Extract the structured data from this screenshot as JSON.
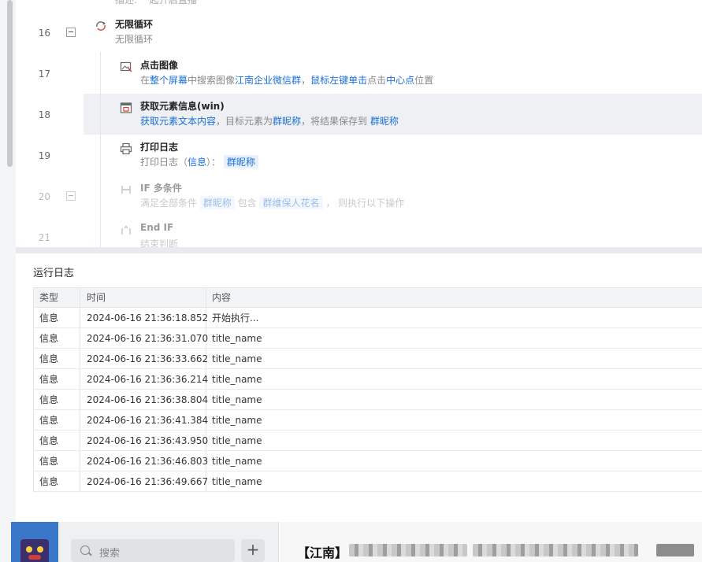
{
  "flow": {
    "top_partial_text": "描述: 一起开启直播",
    "rows": [
      {
        "line": "16",
        "title": "无限循环",
        "desc": "无限循环"
      },
      {
        "line": "17",
        "title": "点击图像",
        "desc_parts": [
          "在",
          "整个屏幕",
          "中搜索图像",
          "江南企业微信群",
          "，",
          "鼠标左键单击",
          "点击",
          "中心点",
          "位置"
        ]
      },
      {
        "line": "18",
        "title": "获取元素信息(win)",
        "desc_parts": [
          "获取元素文本内容",
          "，目标元素为",
          "群昵称",
          "，将结果保存到 ",
          "群昵称"
        ]
      },
      {
        "line": "19",
        "title": "打印日志",
        "desc_parts": [
          "打印日志（",
          "信息",
          "）： ",
          "群昵称"
        ]
      },
      {
        "line": "20",
        "title": "IF 多条件",
        "desc_parts": [
          "满足全部条件 ",
          "群昵称",
          " 包含 ",
          "群维保人花名",
          " ， 则执行以下操作"
        ]
      },
      {
        "line": "21",
        "title": "End IF",
        "desc": "结束判断"
      }
    ]
  },
  "log": {
    "title": "运行日志",
    "columns": [
      "类型",
      "时间",
      "内容"
    ],
    "rows": [
      [
        "信息",
        "2024-06-16 21:36:18.852",
        "开始执行..."
      ],
      [
        "信息",
        "2024-06-16 21:36:31.070",
        "title_name"
      ],
      [
        "信息",
        "2024-06-16 21:36:33.662",
        "title_name"
      ],
      [
        "信息",
        "2024-06-16 21:36:36.214",
        "title_name"
      ],
      [
        "信息",
        "2024-06-16 21:36:38.804",
        "title_name"
      ],
      [
        "信息",
        "2024-06-16 21:36:41.384",
        "title_name"
      ],
      [
        "信息",
        "2024-06-16 21:36:43.950",
        "title_name"
      ],
      [
        "信息",
        "2024-06-16 21:36:46.803",
        "title_name"
      ],
      [
        "信息",
        "2024-06-16 21:36:49.667",
        "title_name"
      ]
    ]
  },
  "wechat": {
    "search_placeholder": "搜索",
    "add_symbol": "+",
    "chat_title": "【江南】"
  },
  "colors": {
    "accent": "#1a6fd8",
    "chip_bg": "#e8f0fc",
    "wechat_sidebar": "#3a77c8"
  },
  "icons": [
    "loop-icon",
    "click-image-icon",
    "element-info-icon",
    "print-log-icon",
    "if-condition-icon",
    "end-if-icon",
    "collapse-icon",
    "search-icon",
    "add-icon"
  ]
}
